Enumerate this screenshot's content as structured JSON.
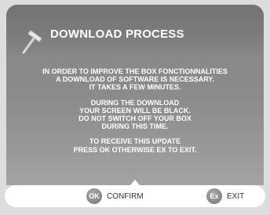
{
  "dialog": {
    "title": "DOWNLOAD PROCESS",
    "icon": "hammer-icon"
  },
  "message": {
    "paragraph1": [
      "IN ORDER TO IMPROVE THE BOX FONCTIONNALITIES",
      "A DOWNLOAD OF SOFTWARE IS NECESSARY.",
      "IT TAKES A FEW MINUTES."
    ],
    "paragraph2": [
      "DURING THE DOWNLOAD",
      "YOUR SCREEN WILL BE BLACK.",
      "DO NOT SWITCH OFF YOUR BOX",
      "DURING THIS TIME."
    ],
    "paragraph3": [
      "TO RECEIVE THIS UPDATE",
      "PRESS OK OTHERWISE EX TO EXIT."
    ]
  },
  "buttons": {
    "confirm": {
      "key": "OK",
      "label": "CONFIRM"
    },
    "exit": {
      "key": "Ex",
      "label": "EXIT"
    }
  },
  "colors": {
    "panel": "#8a8a8a",
    "title_bar": "#7a7a7a",
    "text": "#ffffff",
    "button_circle": "#8a8a8a"
  }
}
